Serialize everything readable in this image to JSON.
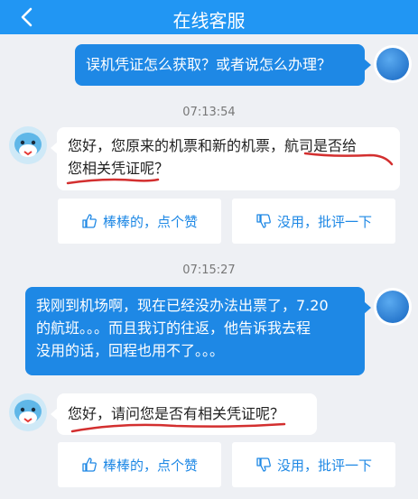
{
  "header": {
    "title": "在线客服",
    "back_icon": "chevron-left-icon"
  },
  "messages": [
    {
      "role": "user",
      "text": "误机凭证怎么获取？或者说怎么办理？"
    },
    {
      "role": "agent",
      "time": "07:13:54",
      "line1": "您好，您原来的机票和新的机票，航司是否给",
      "line2": "您相关凭证呢？"
    },
    {
      "role": "user",
      "time": "07:15:27",
      "line1": "我刚到机场啊，现在已经没办法出票了，7.20",
      "line2": "的航班。。。而且我订的往返，他告诉我去程",
      "line3": "没用的话，回程也用不了。。。"
    },
    {
      "role": "agent",
      "text": "您好，请问您是否有相关凭证呢？"
    }
  ],
  "rating": {
    "like": "棒棒的，点个赞",
    "dislike": "没用，批评一下"
  },
  "colors": {
    "header": "#2196f3",
    "user_bubble": "#1e88e5",
    "background": "#eef0f4",
    "annotation": "#d32f2f"
  }
}
